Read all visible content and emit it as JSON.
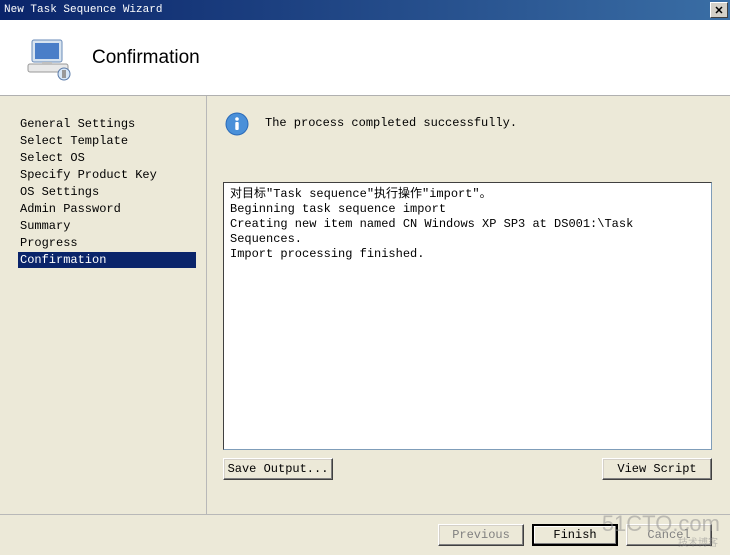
{
  "window": {
    "title": "New Task Sequence Wizard",
    "close_label": "✕"
  },
  "header": {
    "title": "Confirmation"
  },
  "sidebar": {
    "items": [
      {
        "label": "General Settings"
      },
      {
        "label": "Select Template"
      },
      {
        "label": "Select OS"
      },
      {
        "label": "Specify Product Key"
      },
      {
        "label": "OS Settings"
      },
      {
        "label": "Admin Password"
      },
      {
        "label": "Summary"
      },
      {
        "label": "Progress"
      },
      {
        "label": "Confirmation"
      }
    ],
    "selected_index": 8
  },
  "content": {
    "status_text": "The process completed successfully.",
    "output_text": "对目标\"Task sequence\"执行操作\"import\"。\nBeginning task sequence import\nCreating new item named CN Windows XP SP3 at DS001:\\Task Sequences.\nImport processing finished.",
    "save_output_label": "Save Output...",
    "view_script_label": "View Script"
  },
  "footer": {
    "previous_label": "Previous",
    "finish_label": "Finish",
    "cancel_label": "Cancel"
  },
  "watermark": {
    "main": "51CTO.com",
    "sub": "技术博客"
  }
}
